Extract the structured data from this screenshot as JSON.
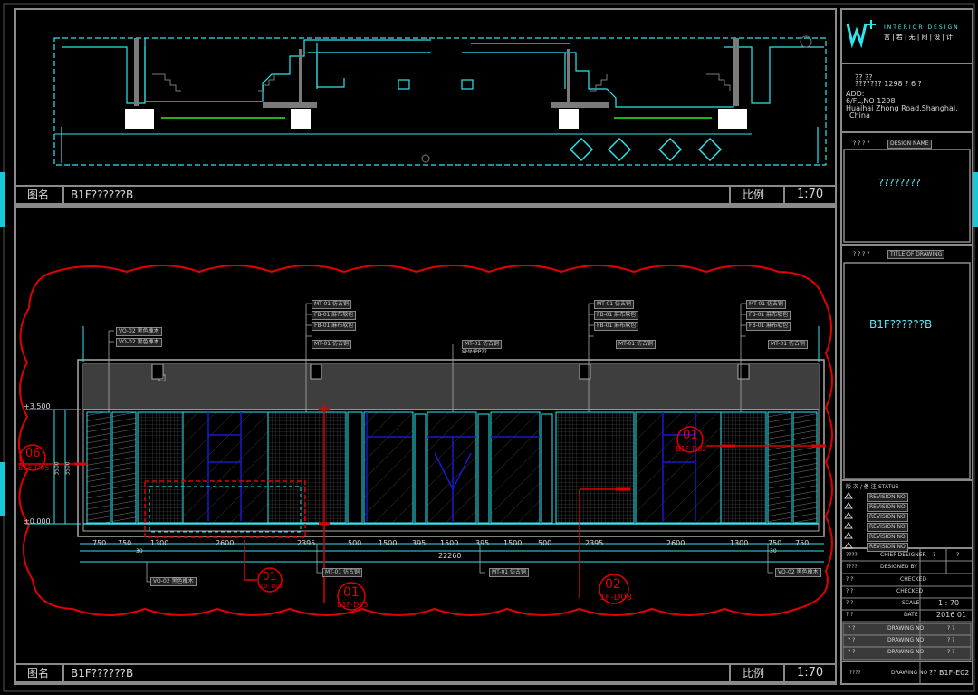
{
  "logo": {
    "line1": "INTERIOR DESIGN",
    "line2": "言 | 若 | 无 | 间 | 设 | 计"
  },
  "company": {
    "addr1": "?? ??",
    "addr2": "??????? 1298 ? 6 ?",
    "addr3": "ADD:",
    "addr4": "6/FL,NO 1298",
    "addr5": "Huaihai Zhong Road,Shanghai,",
    "addr6": "China"
  },
  "project": {
    "label": "? ? ? ?",
    "label_en": "DESIGN NAME",
    "name": "????????"
  },
  "drawing": {
    "label": "? ? ? ?",
    "label_en": "TITLE OF DRAWING",
    "name": "B1F??????B"
  },
  "revision": {
    "label": "版 次 / 备 注",
    "label_en": "STATUS",
    "rows": [
      "REVISION NO",
      "REVISION NO",
      "REVISION NO",
      "REVISION NO",
      "REVISION NO",
      "REVISION NO"
    ]
  },
  "signoff": {
    "chief_label": "????",
    "chief_en": "CHIEF DESIGNER",
    "chief_v1": "?",
    "chief_v2": "?",
    "r2_label": "????",
    "r2_en": "DESIGNED BY",
    "r3_label": "? ?",
    "r3_en": "CHECKED",
    "r4_label": "? ?",
    "r4_en": "CHECKED",
    "scale_label": "? ?",
    "scale_en": "SCALE",
    "scale_val": "1 : 70",
    "date_label": "? ?",
    "date_en": "DATE",
    "date_val": "2016 01",
    "p1": "? ?",
    "p1_en": "DRAWING NO",
    "p1_v": "? ?",
    "p2": "? ?",
    "p2_en": "DRAWING NO",
    "p2_v": "? ?",
    "p3": "? ?",
    "p3_en": "DRAWING NO",
    "p3_v": "? ?"
  },
  "sheet": {
    "label": "????",
    "label_en": "DRAWING NO",
    "number": "?? B1F-E02"
  },
  "top_view": {
    "title_label": "图名",
    "title": "B1F??????B",
    "scale_label": "比例",
    "scale": "1:70"
  },
  "bottom_view": {
    "title_label": "图名",
    "title": "B1F??????B",
    "scale_label": "比例",
    "scale": "1:70"
  },
  "elevation": {
    "level_top": "+3.500",
    "level_bottom": "±0.000",
    "height_dims": [
      "3500",
      "3500"
    ],
    "dims": [
      "750",
      "750",
      "1300",
      "2600",
      "2395",
      "500",
      "1500",
      "395",
      "1500",
      "395",
      "1500",
      "500",
      "2395",
      "2600",
      "1300",
      "750",
      "750"
    ],
    "total_dim": "22260",
    "sub_dims": [
      "30",
      "30"
    ],
    "materials_top_left": [
      "VO-02  黑色橡木",
      "VO-02  黑色橡木"
    ],
    "materials_group": [
      "MT-01  仿古铜",
      "FB-01  麻布软包",
      "FB-01  麻布软包",
      "MT-01  仿古铜"
    ],
    "material_center": "MT-01  仿古铜",
    "material_center_note": "SMMPP??",
    "materials_bottom": [
      "VO-02  黑色橡木",
      "MT-01  仿古铜",
      "MT-01  仿古铜",
      "VO-02  黑色橡木"
    ]
  },
  "callouts": [
    {
      "num": "06",
      "ref": "B1F-D05"
    },
    {
      "num": "01",
      "ref": "B1F-D02"
    },
    {
      "num": "01",
      "ref": "B1F-D08"
    },
    {
      "num": "01",
      "ref": "B1F-D03"
    },
    {
      "num": "02",
      "ref": "1F-D08"
    }
  ],
  "colors": {
    "cyan": "#2ee6ee",
    "grey": "#8a8a8a",
    "red": "#e00000",
    "blue": "#1818d0",
    "green": "#20b020"
  }
}
